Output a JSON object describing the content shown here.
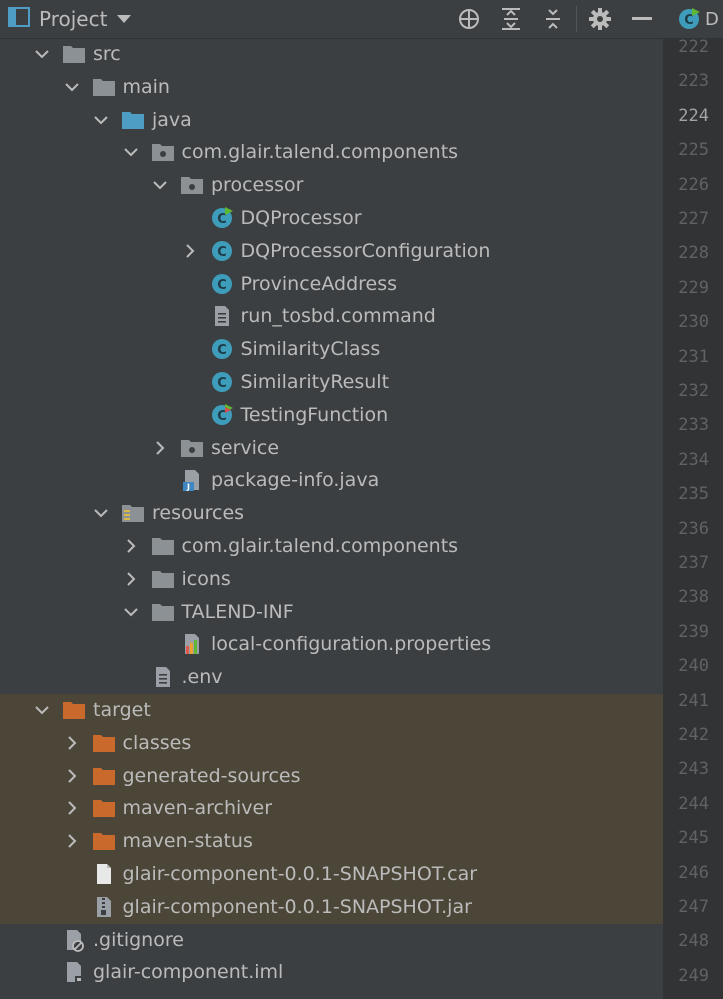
{
  "header": {
    "title": "Project",
    "buttons": [
      {
        "name": "locate-icon"
      },
      {
        "name": "expand-all-icon"
      },
      {
        "name": "collapse-all-icon"
      },
      {
        "name": "gear-icon"
      },
      {
        "name": "minimize-icon"
      }
    ]
  },
  "editor_tab": {
    "label": "D",
    "icon": "java-class-run-icon"
  },
  "tree": [
    {
      "label": "src",
      "depth": 1,
      "arrow": "down",
      "icon": "folder-gray"
    },
    {
      "label": "main",
      "depth": 2,
      "arrow": "down",
      "icon": "folder-gray"
    },
    {
      "label": "java",
      "depth": 3,
      "arrow": "down",
      "icon": "folder-blue"
    },
    {
      "label": "com.glair.talend.components",
      "depth": 4,
      "arrow": "down",
      "icon": "package"
    },
    {
      "label": "processor",
      "depth": 5,
      "arrow": "down",
      "icon": "package"
    },
    {
      "label": "DQProcessor",
      "depth": 6,
      "arrow": "none",
      "icon": "class-run"
    },
    {
      "label": "DQProcessorConfiguration",
      "depth": 6,
      "arrow": "right",
      "icon": "class"
    },
    {
      "label": "ProvinceAddress",
      "depth": 6,
      "arrow": "none",
      "icon": "class"
    },
    {
      "label": "run_tosbd.command",
      "depth": 6,
      "arrow": "none",
      "icon": "text-file"
    },
    {
      "label": "SimilarityClass",
      "depth": 6,
      "arrow": "none",
      "icon": "class"
    },
    {
      "label": "SimilarityResult",
      "depth": 6,
      "arrow": "none",
      "icon": "class"
    },
    {
      "label": "TestingFunction",
      "depth": 6,
      "arrow": "none",
      "icon": "class-test"
    },
    {
      "label": "service",
      "depth": 5,
      "arrow": "right",
      "icon": "package"
    },
    {
      "label": "package-info.java",
      "depth": 5,
      "arrow": "none",
      "icon": "java-file"
    },
    {
      "label": "resources",
      "depth": 3,
      "arrow": "down",
      "icon": "folder-resources"
    },
    {
      "label": "com.glair.talend.components",
      "depth": 4,
      "arrow": "right",
      "icon": "folder-gray"
    },
    {
      "label": "icons",
      "depth": 4,
      "arrow": "right",
      "icon": "folder-gray"
    },
    {
      "label": "TALEND-INF",
      "depth": 4,
      "arrow": "down",
      "icon": "folder-gray"
    },
    {
      "label": "local-configuration.properties",
      "depth": 5,
      "arrow": "none",
      "icon": "properties-file"
    },
    {
      "label": ".env",
      "depth": 4,
      "arrow": "none",
      "icon": "text-file"
    },
    {
      "label": "target",
      "depth": 1,
      "arrow": "down",
      "icon": "folder-orange",
      "excluded": true
    },
    {
      "label": "classes",
      "depth": 2,
      "arrow": "right",
      "icon": "folder-orange",
      "excluded": true
    },
    {
      "label": "generated-sources",
      "depth": 2,
      "arrow": "right",
      "icon": "folder-orange",
      "excluded": true
    },
    {
      "label": "maven-archiver",
      "depth": 2,
      "arrow": "right",
      "icon": "folder-orange",
      "excluded": true
    },
    {
      "label": "maven-status",
      "depth": 2,
      "arrow": "right",
      "icon": "folder-orange",
      "excluded": true
    },
    {
      "label": "glair-component-0.0.1-SNAPSHOT.car",
      "depth": 2,
      "arrow": "none",
      "icon": "blank-file",
      "excluded": true
    },
    {
      "label": "glair-component-0.0.1-SNAPSHOT.jar",
      "depth": 2,
      "arrow": "none",
      "icon": "archive-file",
      "excluded": true
    },
    {
      "label": ".gitignore",
      "depth": 1,
      "arrow": "none",
      "icon": "ignore-file"
    },
    {
      "label": "glair-component.iml",
      "depth": 1,
      "arrow": "none",
      "icon": "iml-file"
    }
  ],
  "gutter": {
    "line_numbers": [
      "222",
      "223",
      "224",
      "225",
      "226",
      "227",
      "228",
      "229",
      "230",
      "231",
      "232",
      "233",
      "234",
      "235",
      "236",
      "237",
      "238",
      "239",
      "240",
      "241",
      "242",
      "243",
      "244",
      "245",
      "246",
      "247",
      "248",
      "249"
    ],
    "current_line": "224"
  },
  "colors": {
    "background": "#3c3f41",
    "excluded_background": "#4b4637",
    "folder_gray": "#8c9196",
    "folder_blue": "#4e9dc4",
    "folder_orange": "#c96a2c",
    "class_teal": "#3e9dbb",
    "run_green": "#5fb832"
  }
}
